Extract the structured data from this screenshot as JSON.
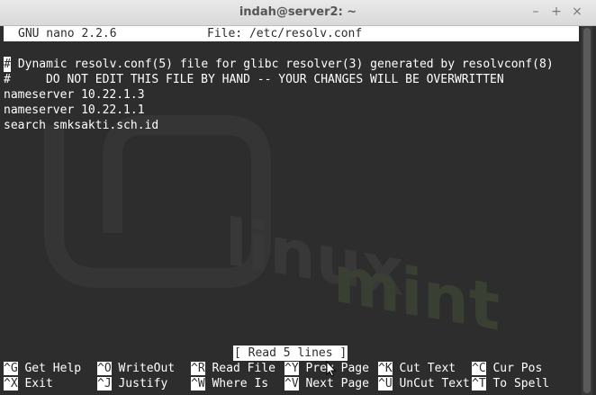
{
  "window": {
    "title": "indah@server2: ~",
    "buttons": {
      "close": "×",
      "maximize": "+",
      "minimize": "–"
    }
  },
  "nano": {
    "version": "GNU nano 2.2.6",
    "file": "File: /etc/resolv.conf",
    "first_line_cursor_char": "#",
    "first_line_rest": " Dynamic resolv.conf(5) file for glibc resolver(3) generated by resolvconf(8)",
    "lines": [
      "#     DO NOT EDIT THIS FILE BY HAND -- YOUR CHANGES WILL BE OVERWRITTEN",
      "nameserver 10.22.1.3",
      "nameserver 10.22.1.1",
      "search smksakti.sch.id"
    ],
    "status": "[ Read 5 lines ]",
    "shortcuts_row1": [
      {
        "key": "^G",
        "label": " Get Help"
      },
      {
        "key": "^O",
        "label": " WriteOut"
      },
      {
        "key": "^R",
        "label": " Read File"
      },
      {
        "key": "^Y",
        "label": " Prev Page"
      },
      {
        "key": "^K",
        "label": " Cut Text"
      },
      {
        "key": "^C",
        "label": " Cur Pos"
      }
    ],
    "shortcuts_row2": [
      {
        "key": "^X",
        "label": " Exit"
      },
      {
        "key": "^J",
        "label": " Justify"
      },
      {
        "key": "^W",
        "label": " Where Is"
      },
      {
        "key": "^V",
        "label": " Next Page"
      },
      {
        "key": "^U",
        "label": " UnCut Text"
      },
      {
        "key": "^T",
        "label": " To Spell"
      }
    ]
  }
}
